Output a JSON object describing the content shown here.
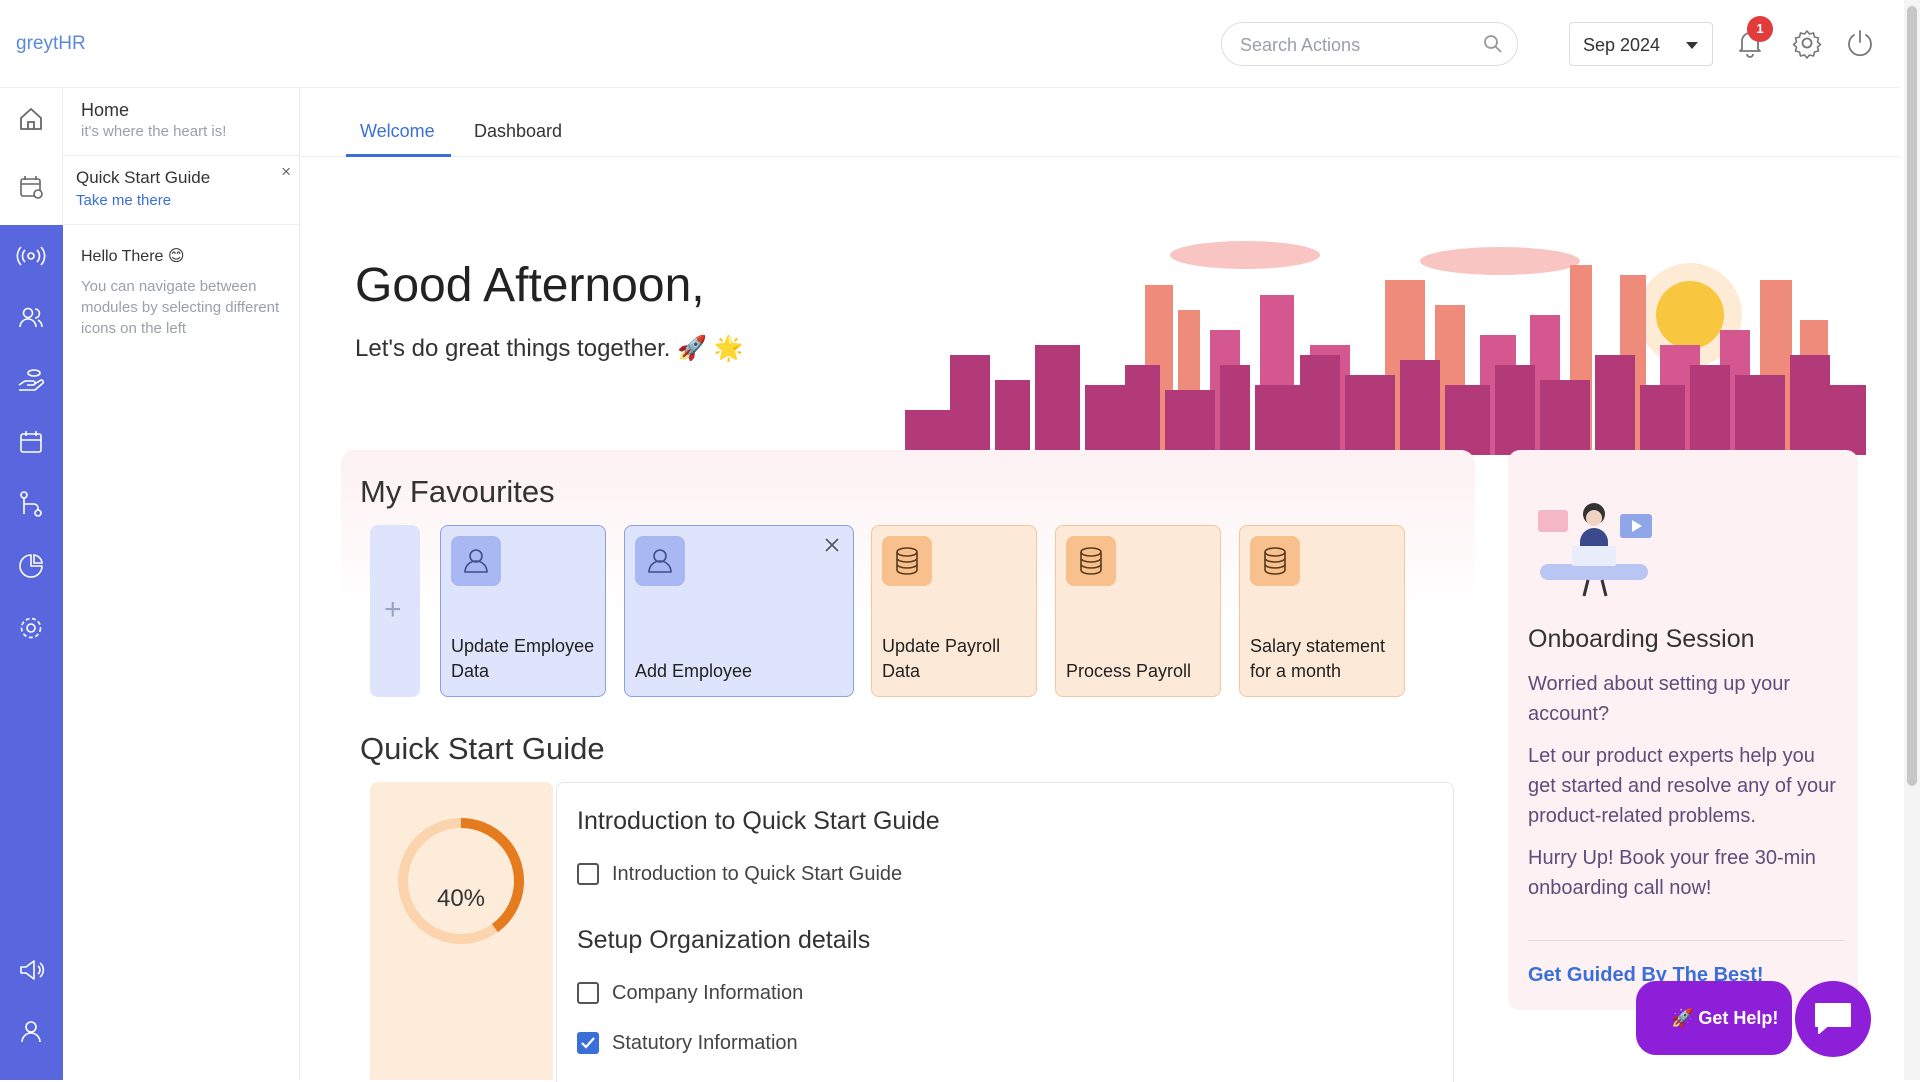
{
  "app": {
    "brand": "greytHR"
  },
  "header": {
    "search_placeholder": "Search Actions",
    "month": "Sep 2024",
    "notifications_count": "1",
    "icons": [
      "search-icon",
      "bell-icon",
      "gear-icon",
      "power-icon"
    ]
  },
  "side_panel": {
    "home_title": "Home",
    "home_subtitle": "it's where the heart is!",
    "qsg_title": "Quick Start Guide",
    "qsg_link": "Take me there",
    "qsg_close": "×",
    "hello_title": "Hello There 😊",
    "hello_desc": "You can navigate between modules by selecting different icons on the left"
  },
  "rail_icons": [
    "home-icon",
    "calendar-settings-icon",
    "broadcast-icon",
    "people-icon",
    "hand-coin-icon",
    "calendar-icon",
    "workflow-icon",
    "pie-chart-icon",
    "settings-cog-icon",
    "megaphone-icon",
    "user-icon"
  ],
  "tabs": [
    {
      "label": "Welcome",
      "active": true
    },
    {
      "label": "Dashboard",
      "active": false
    }
  ],
  "hero": {
    "greeting": "Good Afternoon,",
    "subtitle": "Let's do great things together. 🚀 🌟"
  },
  "favourites": {
    "title": "My Favourites",
    "add_symbol": "+",
    "cards": [
      {
        "label": "Update Employee Data",
        "icon": "person-icon",
        "color": "#dde4fb"
      },
      {
        "label": "Add Employee",
        "icon": "person-icon",
        "color": "#dde4fb"
      },
      {
        "label": "Update Payroll Data",
        "icon": "database-icon",
        "color": "#fde9d7"
      },
      {
        "label": "Process Payroll",
        "icon": "database-icon",
        "color": "#fde9d7"
      },
      {
        "label": "Salary statement for a month",
        "icon": "database-icon",
        "color": "#fde9d7"
      }
    ]
  },
  "quick_start": {
    "title": "Quick Start Guide",
    "progress_label": "40%",
    "progress": 0.4,
    "sections": [
      {
        "heading": "Introduction to Quick Start Guide",
        "items": [
          {
            "label": "Introduction to Quick Start Guide",
            "checked": false
          }
        ]
      },
      {
        "heading": "Setup Organization details",
        "items": [
          {
            "label": "Company Information",
            "checked": false
          },
          {
            "label": "Statutory Information",
            "checked": true
          }
        ]
      }
    ]
  },
  "onboarding": {
    "title": "Onboarding Session",
    "p1": "Worried about setting up your account?",
    "p2": "Let our product experts help you get started and resolve any of your product-related problems.",
    "p3": "Hurry Up! Book your free 30-min onboarding call now!",
    "link": "Get Guided By The Best!"
  },
  "help": {
    "label": "🚀 Get Help!"
  },
  "colors": {
    "accent": "#3a6fd8",
    "rail": "#5867dd",
    "help": "#8e1fd9"
  }
}
